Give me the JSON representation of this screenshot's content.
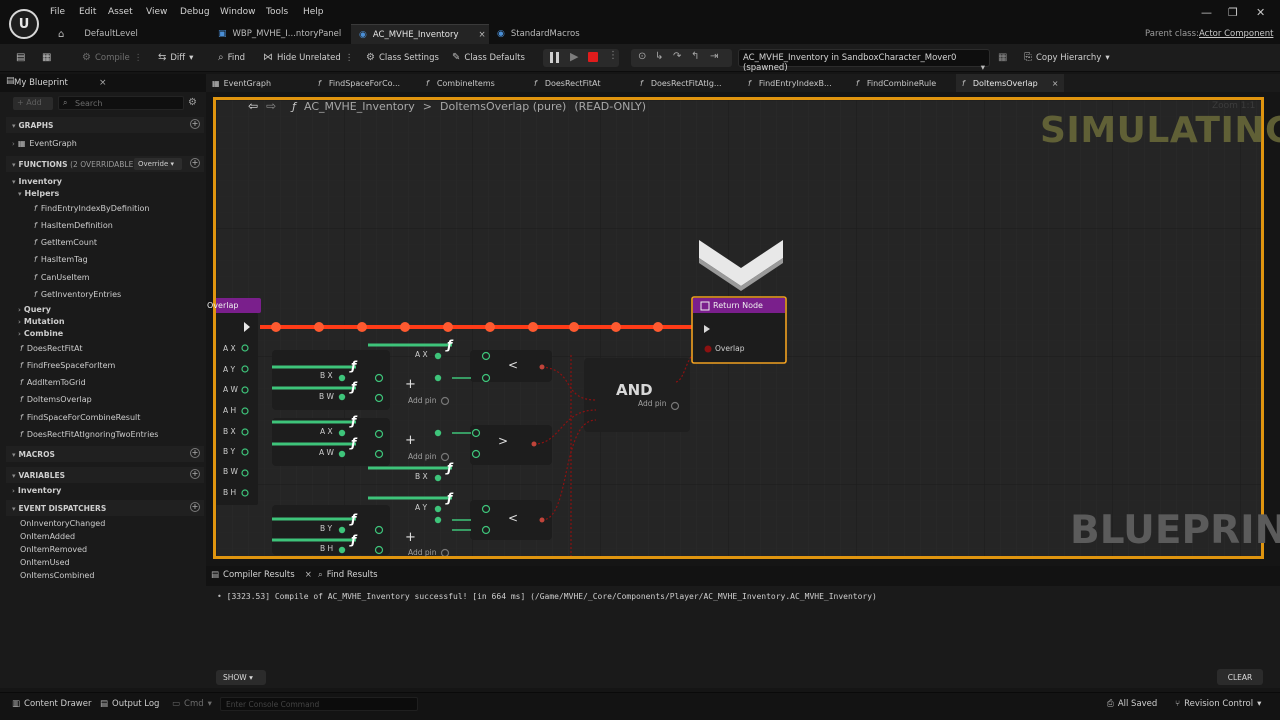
{
  "app": {
    "logo_text": "U",
    "menu": [
      "File",
      "Edit",
      "Asset",
      "View",
      "Debug",
      "Window",
      "Tools",
      "Help"
    ],
    "window_controls": [
      "—",
      "❐",
      "✕"
    ]
  },
  "doc_tabs": [
    {
      "label": "DefaultLevel",
      "icon": "home-icon"
    },
    {
      "label": "WBP_MVHE_I...ntoryPanel",
      "icon": "widget-icon"
    },
    {
      "label": "AC_MVHE_Inventory",
      "icon": "blueprint-icon",
      "close": "×"
    },
    {
      "label": "StandardMacros",
      "icon": "macro-icon"
    }
  ],
  "parent_class": {
    "label": "Parent class:",
    "value": "Actor Component"
  },
  "toolbar": {
    "compile": "Compile",
    "diff": "Diff",
    "find": "Find",
    "hide_unrelated": "Hide Unrelated",
    "class_settings": "Class Settings",
    "class_defaults": "Class Defaults",
    "debug_object": "AC_MVHE_Inventory in SandboxCharacter_Mover0 (spawned)",
    "copy_hierarchy": "Copy Hierarchy"
  },
  "my_blueprint": {
    "title": "My Blueprint",
    "close": "×",
    "add_label": "+ Add",
    "search_placeholder": "Search",
    "sections": {
      "graphs": "GRAPHS",
      "functions": "FUNCTIONS",
      "functions_count": "(2 OVERRIDABLE)",
      "override": "Override",
      "macros": "MACROS",
      "variables": "VARIABLES",
      "event_dispatchers": "EVENT DISPATCHERS"
    },
    "graphs": [
      "EventGraph"
    ],
    "functions": {
      "inventory": "Inventory",
      "helpers": "Helpers",
      "helper_items": [
        "FindEntryIndexByDefinition",
        "HasItemDefinition",
        "GetItemCount",
        "HasItemTag",
        "CanUseItem",
        "GetInventoryEntries"
      ],
      "query": "Query",
      "mutation": "Mutation",
      "combine": "Combine",
      "combine_items": [
        "DoesRectFitAt",
        "FindFreeSpaceForItem",
        "AddItemToGrid",
        "DoItemsOverlap",
        "FindSpaceForCombineResult",
        "DoesRectFitAtIgnoringTwoEntries"
      ]
    },
    "variables": [
      "Inventory"
    ],
    "dispatchers": [
      "OnInventoryChanged",
      "OnItemAdded",
      "OnItemRemoved",
      "OnItemUsed",
      "OnItemsCombined"
    ]
  },
  "graph_tabs": [
    "EventGraph",
    "FindSpaceForCo...",
    "CombineItems",
    "DoesRectFitAt",
    "DoesRectFitAtIg...",
    "FindEntryIndexB...",
    "FindCombineRule",
    "DoItemsOverlap"
  ],
  "graph": {
    "breadcrumb_root": "AC_MVHE_Inventory",
    "breadcrumb_sep": ">",
    "breadcrumb_fn": "DoItemsOverlap (pure)",
    "breadcrumb_state": "(READ-ONLY)",
    "zoom": "Zoom 1:1",
    "simulating": "SIMULATING",
    "watermark": "BLUEPRINT",
    "entry_node_title": "Overlap",
    "entry_pins": [
      "A X",
      "A Y",
      "A W",
      "A H",
      "B X",
      "B Y",
      "B W",
      "B H"
    ],
    "return_node": {
      "title": "Return Node",
      "pin": "Overlap"
    },
    "and_node": {
      "label": "AND",
      "add_pin": "Add pin"
    },
    "add_pin_label": "Add pin",
    "plus_label": "+",
    "lt": "<",
    "gt": ">",
    "math_pins": {
      "n1": [
        "B X",
        "B W"
      ],
      "n1_top": "A X",
      "n2": [
        "A X",
        "A W"
      ],
      "n2_bottom": "B X",
      "n3": [
        "B Y",
        "B H"
      ],
      "n3_top": "A Y"
    }
  },
  "bottom": {
    "compiler_results": "Compiler Results",
    "find_results": "Find Results",
    "close": "×",
    "log": "[3323.53] Compile of AC_MVHE_Inventory successful! [in 664 ms] (/Game/MVHE/_Core/Components/Player/AC_MVHE_Inventory.AC_MVHE_Inventory)",
    "show": "SHOW",
    "clear": "CLEAR"
  },
  "status": {
    "content_drawer": "Content Drawer",
    "output_log": "Output Log",
    "cmd": "Cmd",
    "console_placeholder": "Enter Console Command",
    "all_saved": "All Saved",
    "revision_control": "Revision Control"
  },
  "colors": {
    "accent": "#e0950f",
    "exec_wire": "#ff3b17",
    "float_pin": "#3ec47a",
    "bool_pin": "#8c1111",
    "function_header": "#7a1f8c"
  }
}
